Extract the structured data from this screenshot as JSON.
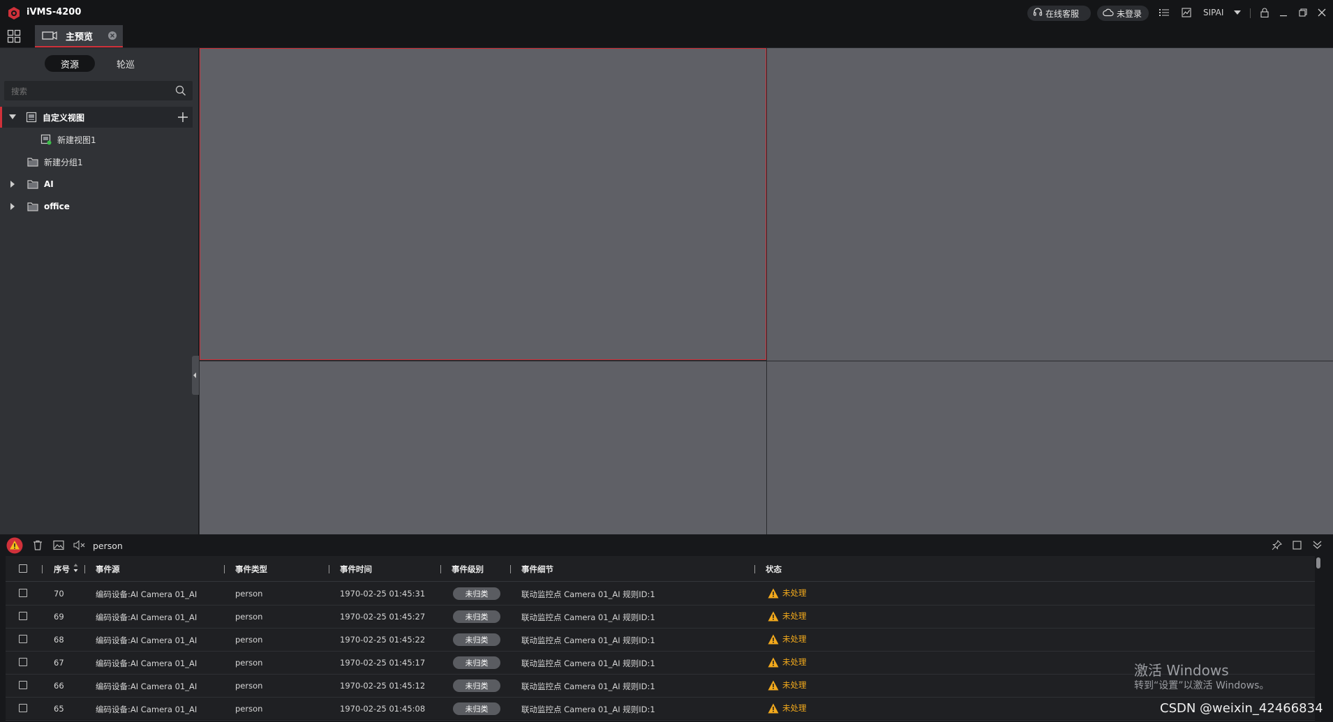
{
  "app": {
    "title": "iVMS-4200",
    "user": "SIPAI"
  },
  "titlebar": {
    "service_label": "在线客服",
    "cloud_label": "未登录"
  },
  "tabs": [
    {
      "label": "主预览"
    }
  ],
  "left_panel": {
    "segments": [
      "资源",
      "轮巡"
    ],
    "search_placeholder": "搜索",
    "tree": [
      {
        "label": "自定义视图",
        "level": 0,
        "expanded": true,
        "selected": true
      },
      {
        "label": "新建视图1",
        "level": 1
      },
      {
        "label": "新建分组1",
        "level": 0
      },
      {
        "label": "AI",
        "level": 0,
        "expandable": true
      },
      {
        "label": "office",
        "level": 0,
        "expandable": true
      }
    ]
  },
  "event_panel": {
    "filter_text": "person",
    "columns": [
      "序号",
      "事件源",
      "事件类型",
      "事件时间",
      "事件级别",
      "事件细节",
      "状态"
    ],
    "rows": [
      {
        "id": "70",
        "source": "编码设备:AI Camera 01_AI",
        "type": "person",
        "time": "1970-02-25 01:45:31",
        "level": "未归类",
        "detail": "联动监控点 Camera 01_AI 规则ID:1",
        "status": "未处理"
      },
      {
        "id": "69",
        "source": "编码设备:AI Camera 01_AI",
        "type": "person",
        "time": "1970-02-25 01:45:27",
        "level": "未归类",
        "detail": "联动监控点 Camera 01_AI 规则ID:1",
        "status": "未处理"
      },
      {
        "id": "68",
        "source": "编码设备:AI Camera 01_AI",
        "type": "person",
        "time": "1970-02-25 01:45:22",
        "level": "未归类",
        "detail": "联动监控点 Camera 01_AI 规则ID:1",
        "status": "未处理"
      },
      {
        "id": "67",
        "source": "编码设备:AI Camera 01_AI",
        "type": "person",
        "time": "1970-02-25 01:45:17",
        "level": "未归类",
        "detail": "联动监控点 Camera 01_AI 规则ID:1",
        "status": "未处理"
      },
      {
        "id": "66",
        "source": "编码设备:AI Camera 01_AI",
        "type": "person",
        "time": "1970-02-25 01:45:12",
        "level": "未归类",
        "detail": "联动监控点 Camera 01_AI 规则ID:1",
        "status": "未处理"
      },
      {
        "id": "65",
        "source": "编码设备:AI Camera 01_AI",
        "type": "person",
        "time": "1970-02-25 01:45:08",
        "level": "未归类",
        "detail": "联动监控点 Camera 01_AI 规则ID:1",
        "status": "未处理"
      }
    ]
  },
  "watermark": {
    "line1": "激活 Windows",
    "line2": "转到“设置”以激活 Windows。",
    "credit": "CSDN @weixin_42466834"
  },
  "colors": {
    "accent": "#d0313a",
    "warning": "#f2a91c",
    "video_pane": "#5f6066",
    "panel": "#303236"
  }
}
